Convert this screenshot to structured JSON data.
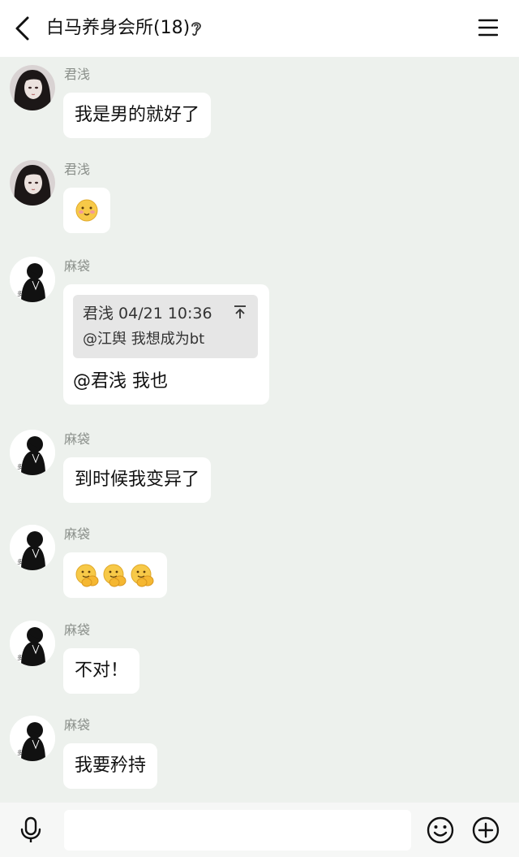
{
  "header": {
    "title": "白马养身会所(18)"
  },
  "messages": [
    {
      "sender": "君浅",
      "text": "我是男的就好了"
    },
    {
      "sender": "君浅",
      "emoji": "smile-emoji"
    },
    {
      "sender": "麻袋",
      "quote": {
        "author_time": "君浅 04/21 10:36",
        "text": "@江舆 我想成为bt"
      },
      "text": "@君浅 我也"
    },
    {
      "sender": "麻袋",
      "text": "到时候我变异了"
    },
    {
      "sender": "麻袋",
      "emoji": "clap-emoji"
    },
    {
      "sender": "麻袋",
      "text": "不对！"
    },
    {
      "sender": "麻袋",
      "text": "我要矜持"
    }
  ],
  "input": {
    "value": ""
  },
  "colors": {
    "background": "#edf1ed",
    "bubble": "#ffffff",
    "header": "#ffffff",
    "quote": "#e6e6e6"
  }
}
